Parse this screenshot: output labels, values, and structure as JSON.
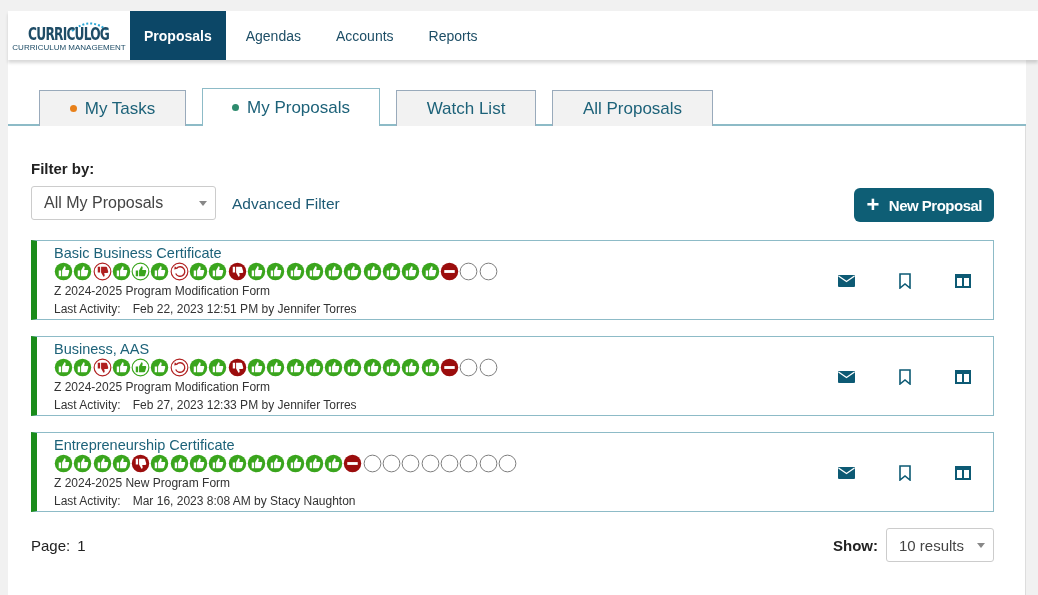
{
  "logo": {
    "name": "CURRICULOG",
    "tagline": "CURRICULUM MANAGEMENT"
  },
  "nav": [
    {
      "label": "Proposals",
      "selected": true
    },
    {
      "label": "Agendas",
      "selected": false
    },
    {
      "label": "Accounts",
      "selected": false
    },
    {
      "label": "Reports",
      "selected": false
    }
  ],
  "tabs": [
    {
      "label": "My Tasks",
      "selected": false,
      "color": "#e8801a"
    },
    {
      "label": "My Proposals",
      "selected": true,
      "color": "#2e8b6e"
    },
    {
      "label": "Watch List",
      "selected": false
    },
    {
      "label": "All Proposals",
      "selected": false
    }
  ],
  "filter": {
    "label": "Filter by:",
    "value": "All My Proposals",
    "advanced": "Advanced Filter"
  },
  "new_button": {
    "icon": "+",
    "label": "New Proposal"
  },
  "proposals": [
    {
      "title": "Basic Business Certificate",
      "form": "Z 2024-2025 Program Modification Form",
      "activity_label": "Last Activity:",
      "activity": "Feb 22, 2023 12:51 PM by Jennifer Torres",
      "steps": [
        {
          "kind": "approved"
        },
        {
          "kind": "approved"
        },
        {
          "kind": "rejected-outline"
        },
        {
          "kind": "approved"
        },
        {
          "kind": "approved-light"
        },
        {
          "kind": "approved"
        },
        {
          "kind": "rollback"
        },
        {
          "kind": "approved"
        },
        {
          "kind": "approved"
        },
        {
          "kind": "rejected"
        },
        {
          "kind": "approved"
        },
        {
          "kind": "approved"
        },
        {
          "kind": "approved"
        },
        {
          "kind": "approved"
        },
        {
          "kind": "approved"
        },
        {
          "kind": "approved"
        },
        {
          "kind": "approved"
        },
        {
          "kind": "approved"
        },
        {
          "kind": "approved"
        },
        {
          "kind": "approved"
        },
        {
          "kind": "blocked"
        },
        {
          "kind": "pending"
        },
        {
          "kind": "pending"
        }
      ]
    },
    {
      "title": "Business, AAS",
      "form": "Z 2024-2025 Program Modification Form",
      "activity_label": "Last Activity:",
      "activity": "Feb 27, 2023 12:33 PM by Jennifer Torres",
      "steps": [
        {
          "kind": "approved"
        },
        {
          "kind": "approved"
        },
        {
          "kind": "rejected-outline"
        },
        {
          "kind": "approved"
        },
        {
          "kind": "approved-light"
        },
        {
          "kind": "approved"
        },
        {
          "kind": "rollback"
        },
        {
          "kind": "approved"
        },
        {
          "kind": "approved"
        },
        {
          "kind": "rejected"
        },
        {
          "kind": "approved"
        },
        {
          "kind": "approved"
        },
        {
          "kind": "approved"
        },
        {
          "kind": "approved"
        },
        {
          "kind": "approved"
        },
        {
          "kind": "approved"
        },
        {
          "kind": "approved"
        },
        {
          "kind": "approved"
        },
        {
          "kind": "approved"
        },
        {
          "kind": "approved"
        },
        {
          "kind": "blocked"
        },
        {
          "kind": "pending"
        },
        {
          "kind": "pending"
        }
      ]
    },
    {
      "title": "Entrepreneurship Certificate",
      "form": "Z 2024-2025 New Program Form",
      "activity_label": "Last Activity:",
      "activity": "Mar 16, 2023 8:08 AM by Stacy Naughton",
      "steps": [
        {
          "kind": "approved"
        },
        {
          "kind": "approved"
        },
        {
          "kind": "approved"
        },
        {
          "kind": "approved"
        },
        {
          "kind": "rejected"
        },
        {
          "kind": "approved"
        },
        {
          "kind": "approved"
        },
        {
          "kind": "approved"
        },
        {
          "kind": "approved"
        },
        {
          "kind": "approved"
        },
        {
          "kind": "approved"
        },
        {
          "kind": "approved"
        },
        {
          "kind": "approved"
        },
        {
          "kind": "approved"
        },
        {
          "kind": "approved"
        },
        {
          "kind": "blocked"
        },
        {
          "kind": "pending"
        },
        {
          "kind": "pending"
        },
        {
          "kind": "pending"
        },
        {
          "kind": "pending"
        },
        {
          "kind": "pending"
        },
        {
          "kind": "pending"
        },
        {
          "kind": "pending"
        },
        {
          "kind": "pending"
        }
      ]
    }
  ],
  "footer": {
    "page_label": "Page:",
    "page": "1",
    "show_label": "Show:",
    "show_value": "10 results"
  }
}
